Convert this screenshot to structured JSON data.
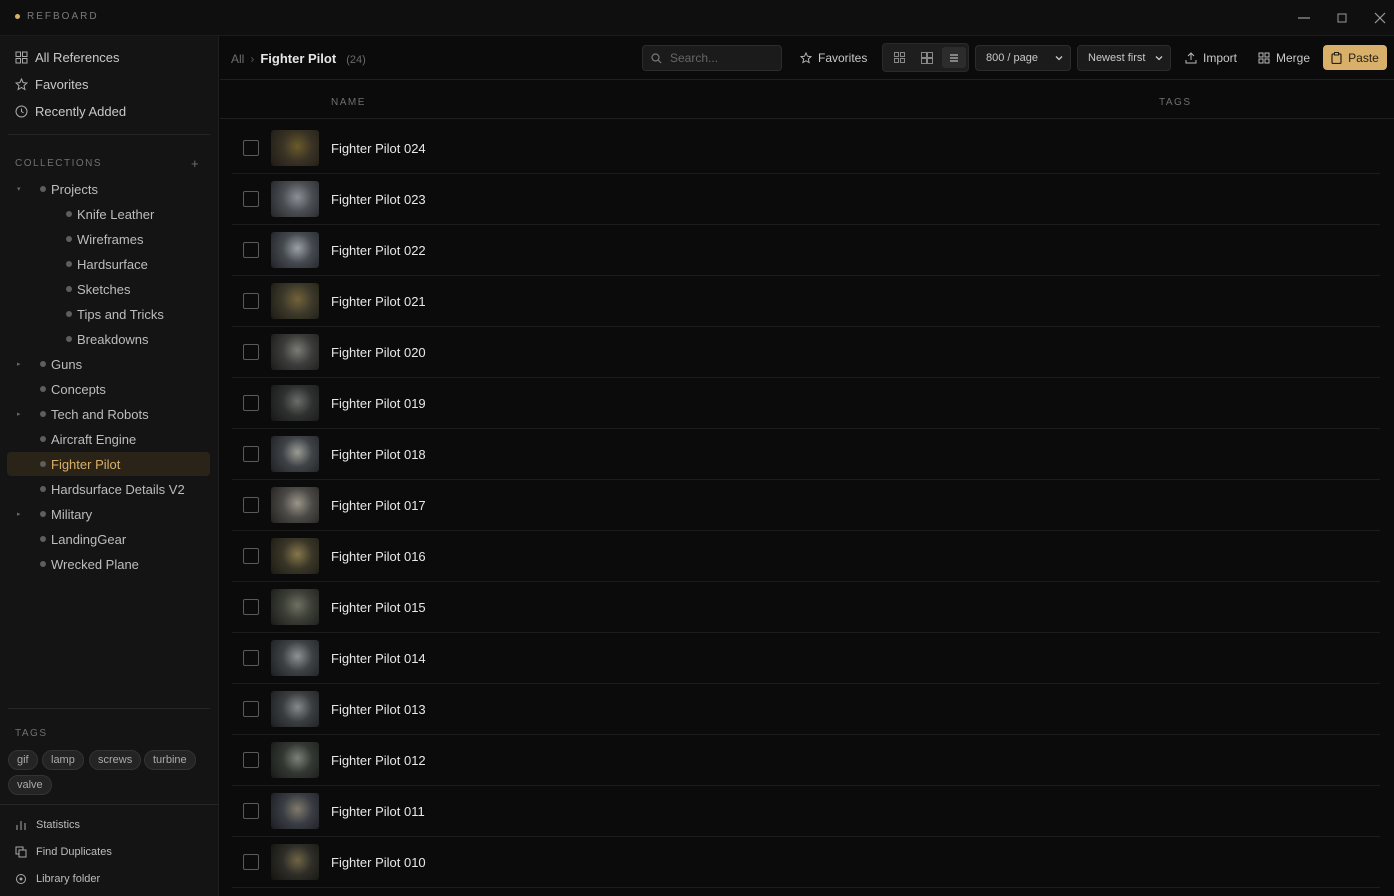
{
  "app": {
    "name": "REFBOARD"
  },
  "window_controls": {
    "minimize": "—",
    "maximize": "□",
    "close": "✕"
  },
  "sidebar": {
    "nav": [
      {
        "label": "All References",
        "icon": "grid-icon"
      },
      {
        "label": "Favorites",
        "icon": "star-icon"
      },
      {
        "label": "Recently Added",
        "icon": "clock-icon"
      }
    ],
    "collections_title": "COLLECTIONS",
    "collections": [
      {
        "label": "Projects",
        "level": 0,
        "expanded": true
      },
      {
        "label": "Knife Leather",
        "level": 1
      },
      {
        "label": "Wireframes",
        "level": 1
      },
      {
        "label": "Hardsurface",
        "level": 1
      },
      {
        "label": "Sketches",
        "level": 1
      },
      {
        "label": "Tips and Tricks",
        "level": 1
      },
      {
        "label": "Breakdowns",
        "level": 1
      },
      {
        "label": "Guns",
        "level": 0,
        "has_children": true
      },
      {
        "label": "Concepts",
        "level": 0
      },
      {
        "label": "Tech and Robots",
        "level": 0,
        "has_children": true
      },
      {
        "label": "Aircraft Engine",
        "level": 0
      },
      {
        "label": "Fighter Pilot",
        "level": 0,
        "selected": true
      },
      {
        "label": "Hardsurface Details V2",
        "level": 0
      },
      {
        "label": "Military",
        "level": 0,
        "has_children": true
      },
      {
        "label": "LandingGear",
        "level": 0
      },
      {
        "label": "Wrecked Plane",
        "level": 0
      }
    ],
    "tags_title": "TAGS",
    "tags": [
      "gif",
      "lamp",
      "screws",
      "turbine",
      "valve"
    ],
    "bottom": [
      {
        "label": "Statistics",
        "icon": "bar-chart-icon"
      },
      {
        "label": "Find Duplicates",
        "icon": "duplicate-icon"
      },
      {
        "label": "Library folder",
        "icon": "folder-icon"
      }
    ]
  },
  "toolbar": {
    "breadcrumb_root": "All",
    "breadcrumb_sep": "›",
    "breadcrumb_current": "Fighter Pilot",
    "item_count": "(24)",
    "search_placeholder": "Search...",
    "favorites_label": "Favorites",
    "per_page": "800 / page",
    "sort": "Newest first",
    "import_label": "Import",
    "merge_label": "Merge",
    "paste_label": "Paste"
  },
  "list": {
    "columns": {
      "name": "NAME",
      "tags": "TAGS"
    },
    "rows": [
      {
        "name": "Fighter Pilot 024"
      },
      {
        "name": "Fighter Pilot 023"
      },
      {
        "name": "Fighter Pilot 022"
      },
      {
        "name": "Fighter Pilot 021"
      },
      {
        "name": "Fighter Pilot 020"
      },
      {
        "name": "Fighter Pilot 019"
      },
      {
        "name": "Fighter Pilot 018"
      },
      {
        "name": "Fighter Pilot 017"
      },
      {
        "name": "Fighter Pilot 016"
      },
      {
        "name": "Fighter Pilot 015"
      },
      {
        "name": "Fighter Pilot 014"
      },
      {
        "name": "Fighter Pilot 013"
      },
      {
        "name": "Fighter Pilot 012"
      },
      {
        "name": "Fighter Pilot 011"
      },
      {
        "name": "Fighter Pilot 010"
      }
    ]
  },
  "colors": {
    "accent": "#d8b06a",
    "background": "#0b0b0b",
    "sidebar": "#141414",
    "selected_bg": "#2a2418"
  }
}
